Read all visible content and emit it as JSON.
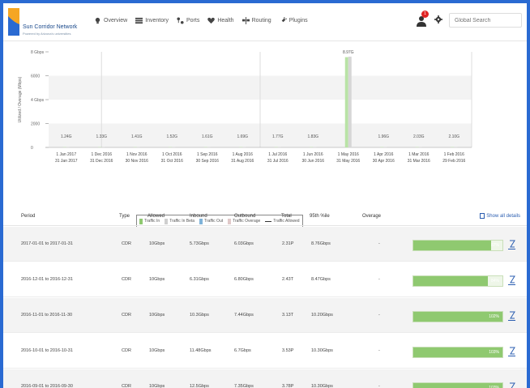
{
  "app": {
    "logo_name": "Sun Corridor Network",
    "logo_tagline": "Powered by Arizona's universities"
  },
  "nav": [
    {
      "label": "Overview",
      "icon": "bulb-icon"
    },
    {
      "label": "Inventory",
      "icon": "list-icon"
    },
    {
      "label": "Ports",
      "icon": "ports-icon"
    },
    {
      "label": "Health",
      "icon": "heart-icon"
    },
    {
      "label": "Routing",
      "icon": "routing-icon"
    },
    {
      "label": "Plugins",
      "icon": "plug-icon"
    }
  ],
  "header": {
    "notification_count": "1",
    "search_placeholder": "Global Search"
  },
  "chart_data": {
    "type": "bar",
    "ylabel": "Utilized / Overage (Mbps)",
    "yticks": [
      "8 Gbps",
      "6000",
      "4 Gbps",
      "2000",
      "0"
    ],
    "categories": [
      "1 Jan 2017 - 31 Jan 2017",
      "1 Dec 2016 - 31 Dec 2016",
      "1 Nov 2016 - 30 Nov 2016",
      "1 Oct 2016 - 31 Oct 2016",
      "1 Sep 2016 - 30 Sep 2016",
      "1 Aug 2016 - 31 Aug 2016",
      "1 Jul 2016 - 31 Jul 2016",
      "1 Jun 2016 - 30 Jun 2016",
      "1 May 2016 - 31 May 2016",
      "1 Apr 2016 - 30 Apr 2016",
      "1 Mar 2016 - 31 Mar 2016",
      "1 Feb 2016 - 29 Feb 2016"
    ],
    "tick_top": [
      "1 Jan 2017",
      "1 Dec 2016",
      "1 Nov 2016",
      "1 Oct 2016",
      "1 Sep 2016",
      "1 Aug 2016",
      "1 Jul 2016",
      "1 Jun 2016",
      "1 May 2016",
      "1 Apr 2016",
      "1 Mar 2016",
      "1 Feb 2016"
    ],
    "tick_bottom": [
      "31 Jan 2017",
      "31 Dec 2016",
      "30 Nov 2016",
      "31 Oct 2016",
      "30 Sep 2016",
      "31 Aug 2016",
      "31 Jul 2016",
      "30 Jun 2016",
      "31 May 2016",
      "30 Apr 2016",
      "31 Mar 2016",
      "29 Feb 2016"
    ],
    "value_labels": [
      "1.24G",
      "1.33G",
      "1.41G",
      "1.52G",
      "1.61G",
      "1.69G",
      "1.77G",
      "1.83G",
      "8.97G",
      "1.96G",
      "2.03G",
      "2.10G"
    ],
    "ylim": [
      0,
      9000
    ],
    "series": [
      {
        "name": "Traffic In",
        "color": "#b9e3a6",
        "values": [
          30,
          30,
          30,
          30,
          30,
          30,
          30,
          30,
          8500,
          30,
          30,
          30
        ]
      },
      {
        "name": "Traffic Out",
        "color": "#d6d6d6",
        "values": [
          20,
          20,
          20,
          20,
          20,
          20,
          20,
          20,
          8550,
          20,
          20,
          20
        ]
      }
    ],
    "legend": [
      {
        "name": "Traffic In",
        "color": "#8fc970",
        "kind": "swatch"
      },
      {
        "name": "Traffic In Beta",
        "color": "#cfcfcf",
        "kind": "swatch"
      },
      {
        "name": "Traffic Out",
        "color": "#7fb3d9",
        "kind": "swatch"
      },
      {
        "name": "Traffic Overage",
        "color": "#e0c9c9",
        "kind": "swatch"
      },
      {
        "name": "Traffic Allowed",
        "color": "#333333",
        "kind": "line"
      }
    ],
    "grid": true,
    "legend_position": "bottom-center"
  },
  "table": {
    "headers": [
      "Period",
      "Type",
      "Allowed",
      "Inbound",
      "Outbound",
      "Total",
      "95th %ile",
      "Overage"
    ],
    "show_all_label": "Show all details",
    "rows": [
      {
        "period": "2017-01-01 to 2017-01-31",
        "type": "CDR",
        "allowed": "10Gbps",
        "inbound": "5.73Gbps",
        "outbound": "6.03Gbps",
        "total": "2.31P",
        "p95": "8.76Gbps",
        "overage": "-",
        "utilization": "87%",
        "fill": 0.87
      },
      {
        "period": "2016-12-01 to 2016-12-31",
        "type": "CDR",
        "allowed": "10Gbps",
        "inbound": "6.31Gbps",
        "outbound": "6.80Gbps",
        "total": "2.43T",
        "p95": "8.47Gbps",
        "overage": "-",
        "utilization": "84%",
        "fill": 0.84
      },
      {
        "period": "2016-11-01 to 2016-11-30",
        "type": "CDR",
        "allowed": "10Gbps",
        "inbound": "10.3Gbps",
        "outbound": "7.44Gbps",
        "total": "3.13T",
        "p95": "10.20Gbps",
        "overage": "-",
        "utilization": "102%",
        "fill": 1.0
      },
      {
        "period": "2016-10-01 to 2016-10-31",
        "type": "CDR",
        "allowed": "10Gbps",
        "inbound": "11.48Gbps",
        "outbound": "6.7Gbps",
        "total": "3.53P",
        "p95": "10.30Gbps",
        "overage": "-",
        "utilization": "103%",
        "fill": 1.0
      },
      {
        "period": "2016-09-01 to 2016-09-30",
        "type": "CDR",
        "allowed": "10Gbps",
        "inbound": "12.5Gbps",
        "outbound": "7.35Gbps",
        "total": "3.78P",
        "p95": "10.30Gbps",
        "overage": "-",
        "utilization": "103%",
        "fill": 1.0
      }
    ]
  }
}
